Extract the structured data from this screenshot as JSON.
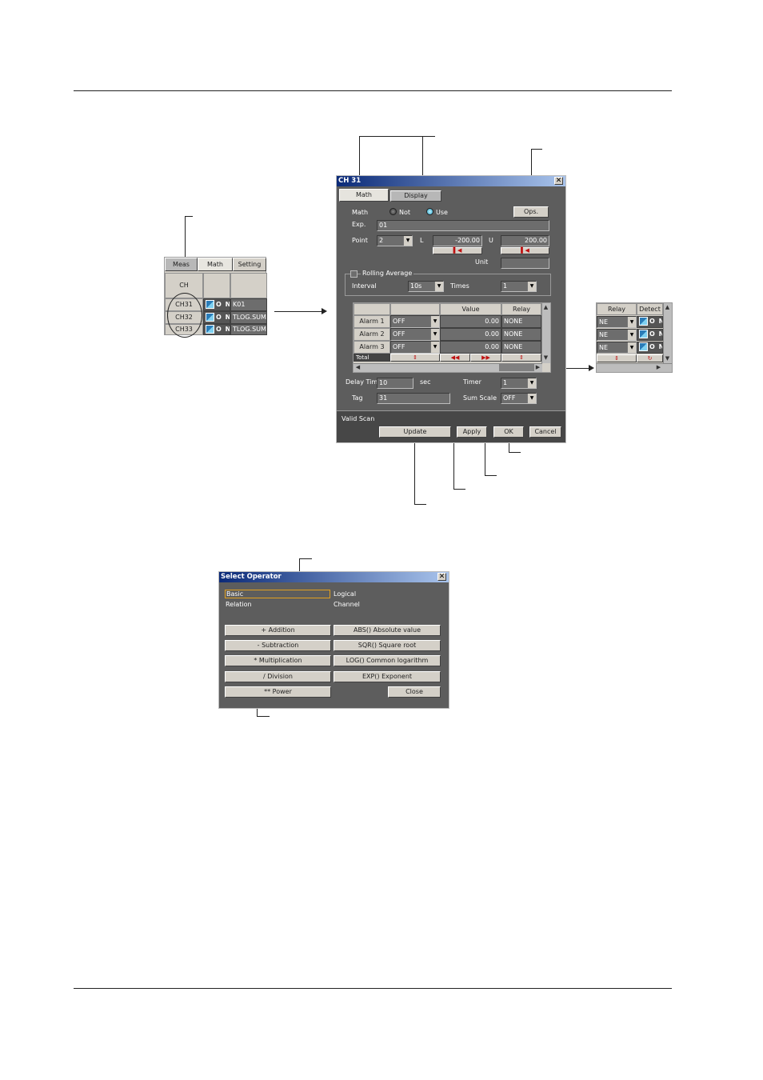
{
  "main_window": {
    "title": "CH 31",
    "close_glyph": "✕",
    "tabs": [
      {
        "label": "Math"
      },
      {
        "label": "Display"
      }
    ],
    "math_label": "Math",
    "radio_not": "Not",
    "radio_use": "Use",
    "ops_button": "Ops.",
    "exp_label": "Exp.",
    "exp_value": "01",
    "point_label": "Point",
    "point_value": "2",
    "l_label": "L",
    "l_value": "-200.00",
    "u_label": "U",
    "u_value": "200.00",
    "unit_label": "Unit",
    "unit_value": "",
    "rolling_label": "Rolling Average",
    "interval_label": "Interval",
    "interval_value": "10s",
    "times_label": "Times",
    "times_value": "1",
    "alarm_headers": [
      "",
      "",
      "Value",
      "Relay"
    ],
    "alarms": [
      {
        "name": "Alarm 1",
        "type": "OFF",
        "value": "0.00",
        "relay": "NONE"
      },
      {
        "name": "Alarm 2",
        "type": "OFF",
        "value": "0.00",
        "relay": "NONE"
      },
      {
        "name": "Alarm 3",
        "type": "OFF",
        "value": "0.00",
        "relay": "NONE"
      }
    ],
    "partial_row_label": "Total",
    "delay_label": "Delay Time",
    "delay_value": "10",
    "sec_label": "sec",
    "timer_label": "Timer",
    "timer_value": "1",
    "tag_label": "Tag",
    "tag_value": "31",
    "sumscale_label": "Sum Scale",
    "sumscale_value": "OFF",
    "status_text": "Valid Scan",
    "buttons": {
      "update": "Update",
      "apply": "Apply",
      "ok": "OK",
      "cancel": "Cancel"
    }
  },
  "channel_list": {
    "tabs": [
      "Meas",
      "Math",
      "Setting"
    ],
    "header_ch": "CH",
    "rows": [
      {
        "ch": "CH31",
        "state": "O N",
        "exp": "K01"
      },
      {
        "ch": "CH32",
        "state": "O N",
        "exp": "TLOG.SUM"
      },
      {
        "ch": "CH33",
        "state": "O N",
        "exp": "TLOG.SUM"
      }
    ]
  },
  "right_snippet": {
    "headers": [
      "Relay",
      "Detect"
    ],
    "rows": [
      {
        "relay": "NE",
        "detect": "O N"
      },
      {
        "relay": "NE",
        "detect": "O N"
      },
      {
        "relay": "NE",
        "detect": "O N"
      }
    ]
  },
  "operator_dialog": {
    "title": "Select Operator",
    "close_glyph": "✕",
    "categories": [
      "Basic",
      "Logical",
      "Relation",
      "Channel"
    ],
    "left_buttons": [
      "+ Addition",
      "- Subtraction",
      "* Multiplication",
      "/ Division",
      "** Power"
    ],
    "right_buttons": [
      "ABS() Absolute value",
      "SQR() Square root",
      "LOG() Common logarithm",
      "EXP() Exponent"
    ],
    "close_button": "Close"
  },
  "colors": {
    "window_bg": "#5d5d5d",
    "title_start": "#0b2a78",
    "title_end": "#a9c4ec",
    "button_bg": "#d4d0c8"
  }
}
